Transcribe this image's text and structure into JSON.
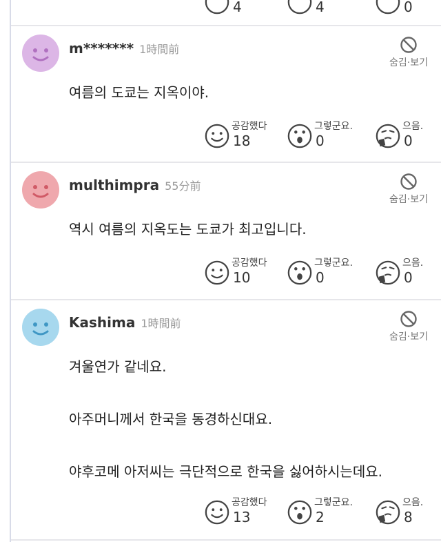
{
  "top_partial": {
    "counts": [
      "4",
      "4",
      "0"
    ]
  },
  "hide_label": "숨김·보기",
  "reaction_labels": {
    "agree": "공감했다",
    "i_see": "그렇군요.",
    "hmm": "으음."
  },
  "comments": [
    {
      "author": "m*******",
      "time": "1時間前",
      "lines": [
        "여름의 도쿄는 지옥이야."
      ],
      "counts": {
        "agree": "18",
        "i_see": "0",
        "hmm": "0"
      },
      "avatar_color": "#dcb6e6"
    },
    {
      "author": "multhimpra",
      "time": "55分前",
      "lines": [
        "역시 여름의 지옥도는 도쿄가 최고입니다."
      ],
      "counts": {
        "agree": "10",
        "i_see": "0",
        "hmm": "0"
      },
      "avatar_color": "#efa8ad"
    },
    {
      "author": "Kashima",
      "time": "1時間前",
      "lines": [
        "겨울연가 같네요.",
        "아주머니께서 한국을 동경하신대요.",
        "야후코메 아저씨는 극단적으로 한국을 싫어하시는데요."
      ],
      "counts": {
        "agree": "13",
        "i_see": "2",
        "hmm": "8"
      },
      "avatar_color": "#a7d8ee"
    }
  ]
}
